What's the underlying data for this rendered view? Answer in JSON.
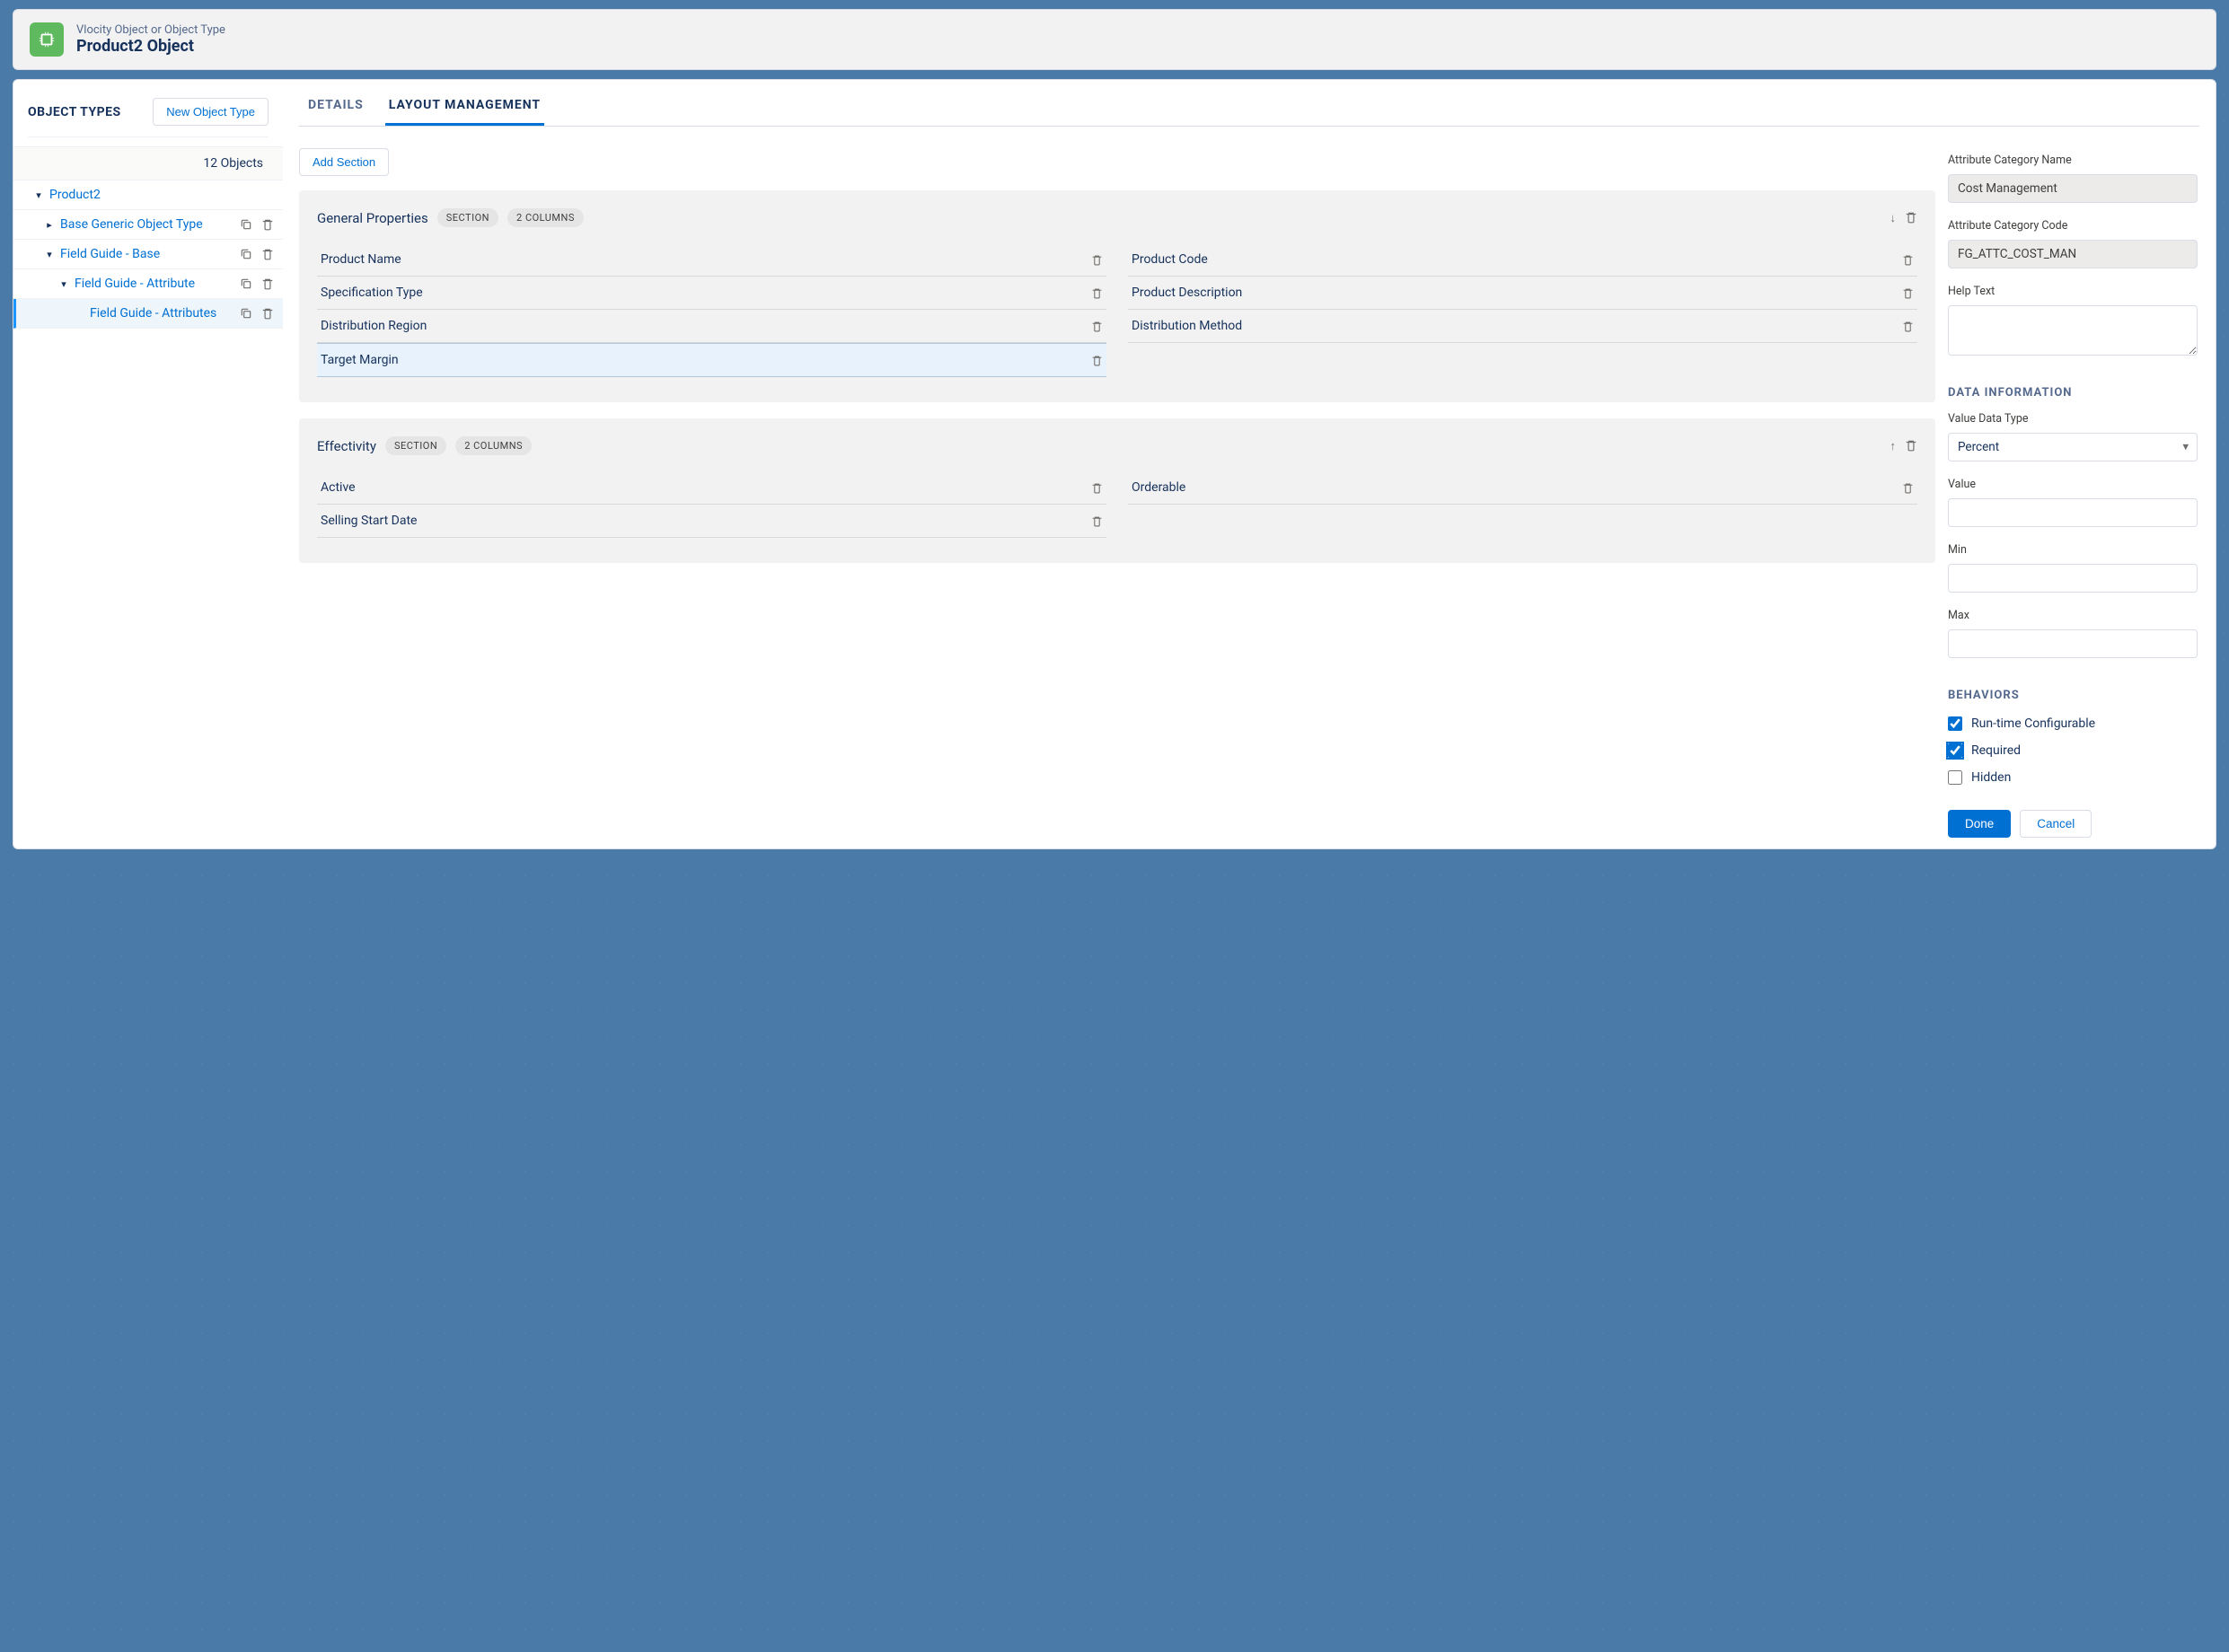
{
  "header": {
    "kicker": "Vlocity Object or Object Type",
    "title": "Product2 Object"
  },
  "sidebar": {
    "title": "OBJECT TYPES",
    "new_button": "New Object Type",
    "count": "12 Objects",
    "tree": {
      "root": "Product2",
      "item_base": "Base Generic Object Type",
      "item_fg_base": "Field Guide - Base",
      "item_fg_attr": "Field Guide - Attribute",
      "item_fg_attrs": "Field Guide - Attributes"
    }
  },
  "tabs": {
    "details": "DETAILS",
    "layout": "LAYOUT MANAGEMENT"
  },
  "actions": {
    "add_section": "Add Section",
    "done": "Done",
    "cancel": "Cancel"
  },
  "sections": [
    {
      "title": "General Properties",
      "type": "SECTION",
      "columns": "2 COLUMNS",
      "direction": "down",
      "left": [
        "Product Name",
        "Specification Type",
        "Distribution Region",
        "Target Margin"
      ],
      "right": [
        "Product Code",
        "Product Description",
        "Distribution Method"
      ],
      "selected_left_index": 3
    },
    {
      "title": "Effectivity",
      "type": "SECTION",
      "columns": "2 COLUMNS",
      "direction": "up",
      "left": [
        "Active",
        "Selling Start Date"
      ],
      "right": [
        "Orderable"
      ]
    }
  ],
  "panel": {
    "attr_cat_name_label": "Attribute Category Name",
    "attr_cat_name_value": "Cost Management",
    "attr_cat_code_label": "Attribute Category Code",
    "attr_cat_code_value": "FG_ATTC_COST_MAN",
    "help_label": "Help Text",
    "help_value": "",
    "data_info_header": "DATA INFORMATION",
    "value_type_label": "Value Data Type",
    "value_type_value": "Percent",
    "value_label": "Value",
    "value_value": "",
    "min_label": "Min",
    "min_value": "",
    "max_label": "Max",
    "max_value": "",
    "behaviors_header": "BEHAVIORS",
    "behaviors": {
      "runtime": {
        "label": "Run-time Configurable",
        "checked": true
      },
      "required": {
        "label": "Required",
        "checked": true
      },
      "hidden": {
        "label": "Hidden",
        "checked": false
      }
    }
  }
}
